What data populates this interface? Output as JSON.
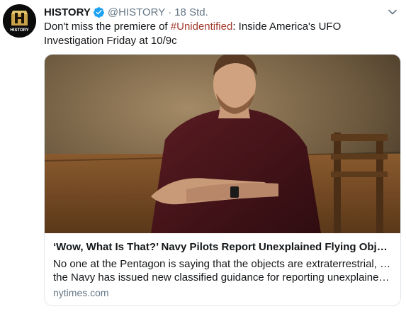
{
  "tweet": {
    "avatar_label": "HISTORY",
    "display_name": "HISTORY",
    "handle": "@HISTORY",
    "separator": "·",
    "timestamp": "18 Std.",
    "text_before": "Don't miss the premiere of ",
    "hashtag": "#Unidentified",
    "text_after": ": Inside America's UFO Investigation Friday at 10/9c",
    "verified_icon": "verified-badge-icon",
    "menu_icon": "chevron-down-icon"
  },
  "card": {
    "title": "‘Wow, What Is That?’ Navy Pilots Report Unexplained Flying Objects",
    "description_line1": "No one at the Pentagon is saying that the objects are extraterrestrial, but",
    "description_line2": "the Navy has issued new classified guidance for reporting unexplained ae...",
    "domain": "nytimes.com"
  },
  "colors": {
    "text": "#14171a",
    "muted": "#657786",
    "hashtag": "#a33a2d",
    "verified": "#1da1f2",
    "border": "#e1e8ed"
  }
}
